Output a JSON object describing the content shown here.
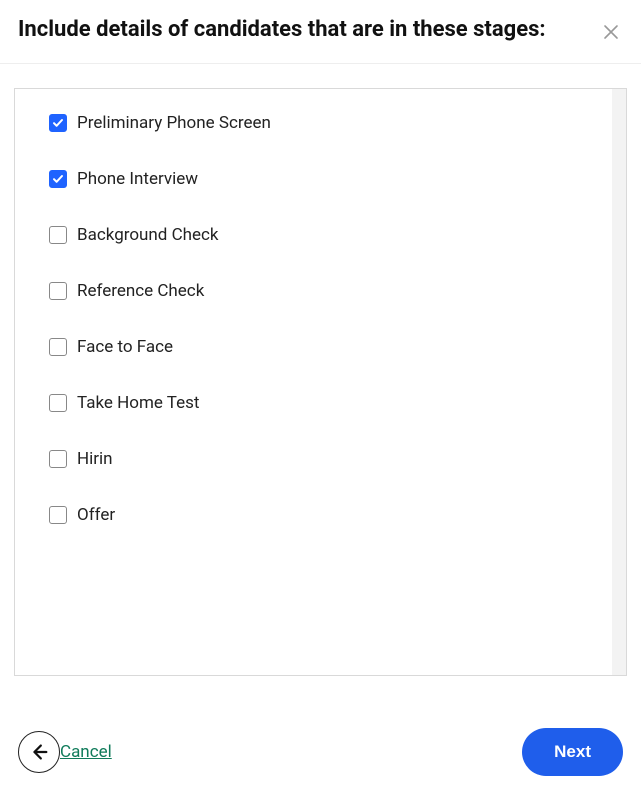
{
  "header": {
    "title": "Include details of candidates that are in these stages:"
  },
  "stages": [
    {
      "label": "Preliminary Phone Screen",
      "checked": true
    },
    {
      "label": "Phone Interview",
      "checked": true
    },
    {
      "label": "Background Check",
      "checked": false
    },
    {
      "label": "Reference Check",
      "checked": false
    },
    {
      "label": "Face to Face",
      "checked": false
    },
    {
      "label": "Take Home Test",
      "checked": false
    },
    {
      "label": "Hirin",
      "checked": false
    },
    {
      "label": "Offer",
      "checked": false
    }
  ],
  "footer": {
    "cancel": "Cancel",
    "next": "Next"
  }
}
